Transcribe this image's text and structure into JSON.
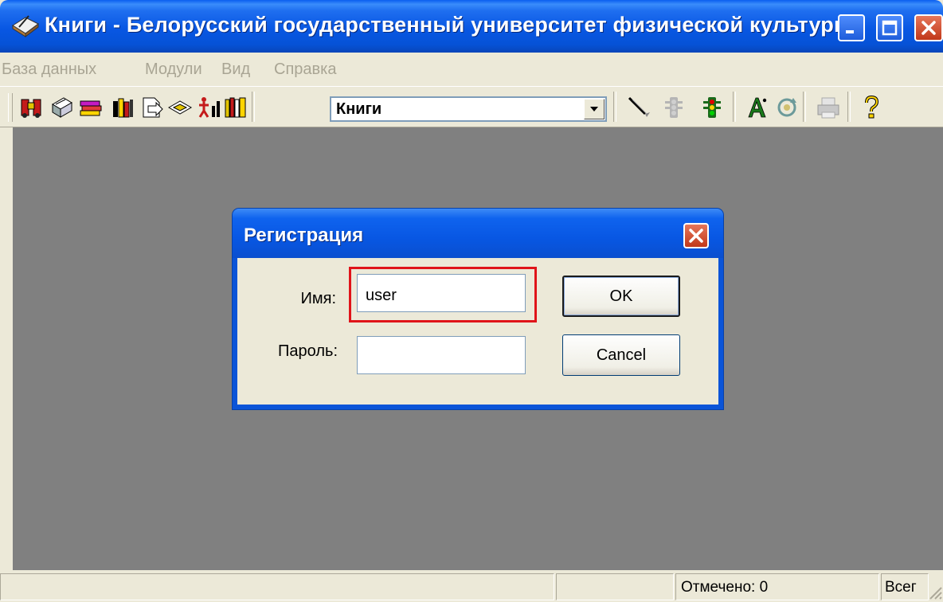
{
  "window": {
    "title": "Книги - Белорусский государственный университет физической культуры"
  },
  "menu": {
    "items": [
      "База данных",
      "Модули",
      "Вид",
      "Справка"
    ]
  },
  "toolbar": {
    "combo_value": "Книги",
    "icons": [
      "binoculars-icon",
      "card-stack-icon",
      "books-stack-icon",
      "books-shelf-icon",
      "page-arrow-icon",
      "book-open-icon",
      "figure-bars-icon",
      "book-columns-icon",
      "pen-icon",
      "traffic-light-off-icon",
      "traffic-light-on-icon",
      "font-letter-icon",
      "refresh-icon",
      "print-icon",
      "help-icon"
    ]
  },
  "dialog": {
    "title": "Регистрация",
    "name_label": "Имя:",
    "name_value": "user",
    "password_label": "Пароль:",
    "password_value": "",
    "ok_label": "OK",
    "cancel_label": "Cancel",
    "highlight_color": "#e0141a"
  },
  "statusbar": {
    "marked": "Отмечено: 0",
    "total": "Всег"
  },
  "colors": {
    "titlebar_blue": "#0857e3",
    "mdi_background": "#808080",
    "face": "#ece9d8"
  }
}
